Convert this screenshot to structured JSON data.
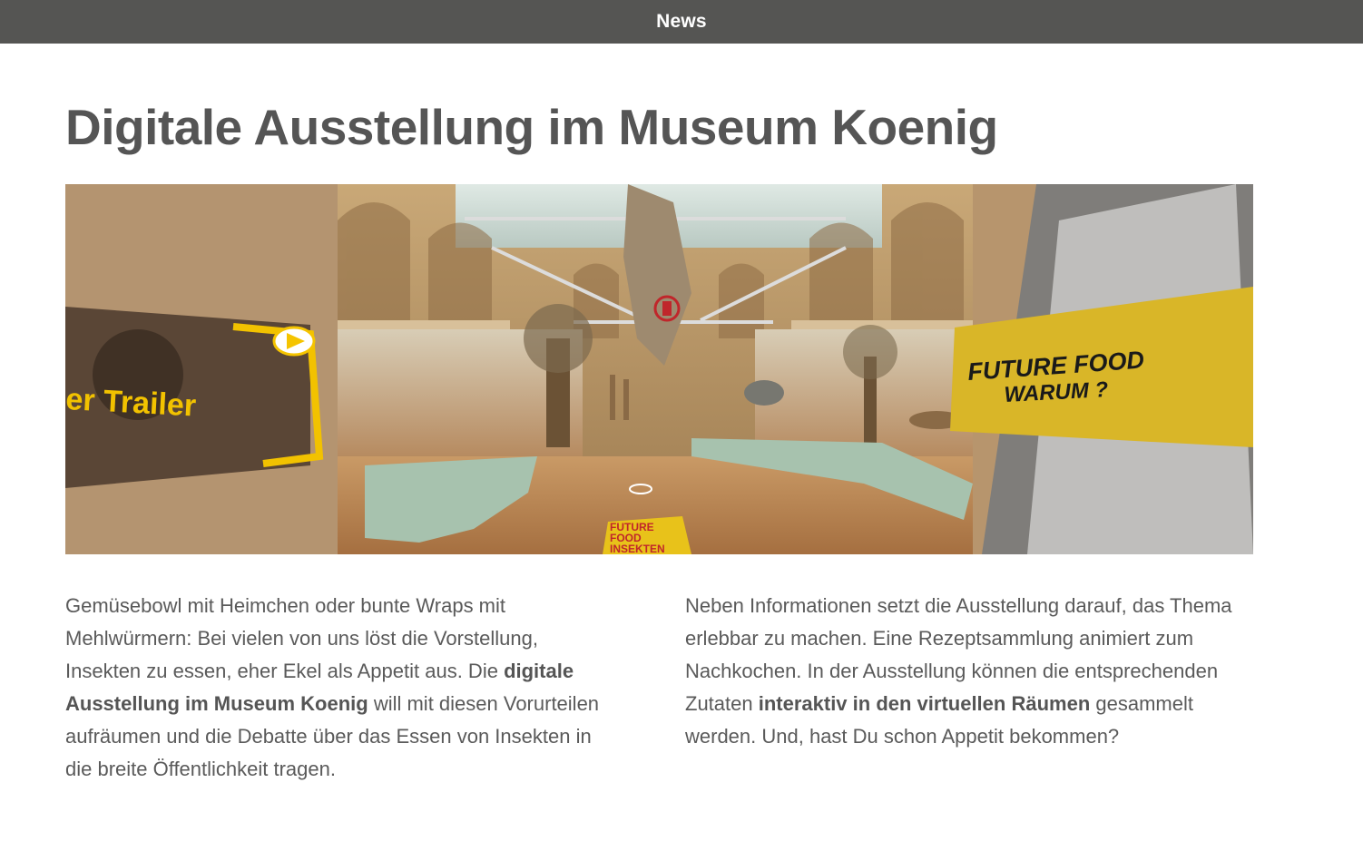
{
  "header": {
    "nav_label": "News"
  },
  "article": {
    "title": "Digitale Ausstellung im Museum Koenig",
    "hero": {
      "trailer_label": "er Trailer",
      "sign_right_line1": "FUTURE FOOD",
      "sign_right_line2": "WARUM ?",
      "floor_sign_line1": "FUTURE",
      "floor_sign_line2": "FOOD",
      "floor_sign_line3": "INSEKTEN",
      "colors": {
        "accent_yellow": "#e8c21a",
        "play_yellow": "#f5c400",
        "marker_red": "#c0262b"
      },
      "icons": [
        "play-icon",
        "info-marker-icon",
        "navigation-ring-icon"
      ]
    },
    "paragraph_left": {
      "part1": "Gemüsebowl mit Heimchen oder bunte Wraps mit Mehlwürmern: Bei vielen von uns löst die Vorstellung, Insekten zu essen, eher Ekel als Appetit aus. Die ",
      "bold": "digitale Ausstellung im Museum Koenig",
      "part2": " will mit diesen Vorur­teilen aufräumen und die Debatte über das Essen von Insekten in die breite Öffentlichkeit tragen."
    },
    "paragraph_right": {
      "part1": "Neben Informationen setzt die Ausstellung darauf, das Thema erlebbar zu machen. Eine Rezeptsammlung animiert zum Nachkochen. In der Ausstellung können die entsprechenden Zutaten ",
      "bold": "interaktiv in den virtuellen Räumen",
      "part2": " gesammelt werden. Und, hast Du schon Appetit bekommen?"
    }
  }
}
